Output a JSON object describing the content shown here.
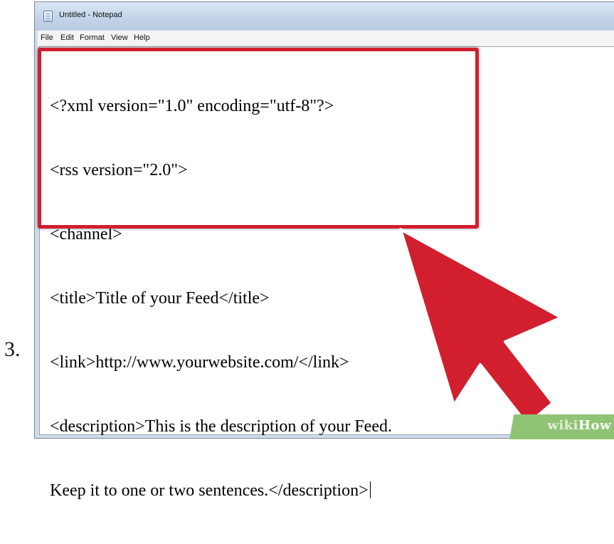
{
  "step": {
    "number": "3."
  },
  "window": {
    "title": "Untitled - Notepad",
    "menu": [
      "File",
      "Edit",
      "Format",
      "View",
      "Help"
    ]
  },
  "editor": {
    "lines": [
      "<?xml version=\"1.0\" encoding=\"utf-8\"?>",
      "<rss version=\"2.0\">",
      "<channel>",
      "<title>Title of your Feed</title>",
      "<link>http://www.yourwebsite.com/</link>",
      "<description>This is the description of your Feed.",
      "Keep it to one or two sentences.</description>"
    ]
  },
  "annotation": {
    "box_color": "#d11f2e",
    "arrow_color": "#d11f2e",
    "icon": "red-pointer-arrow"
  },
  "watermark": {
    "part1": "wiki",
    "part2": "How"
  }
}
